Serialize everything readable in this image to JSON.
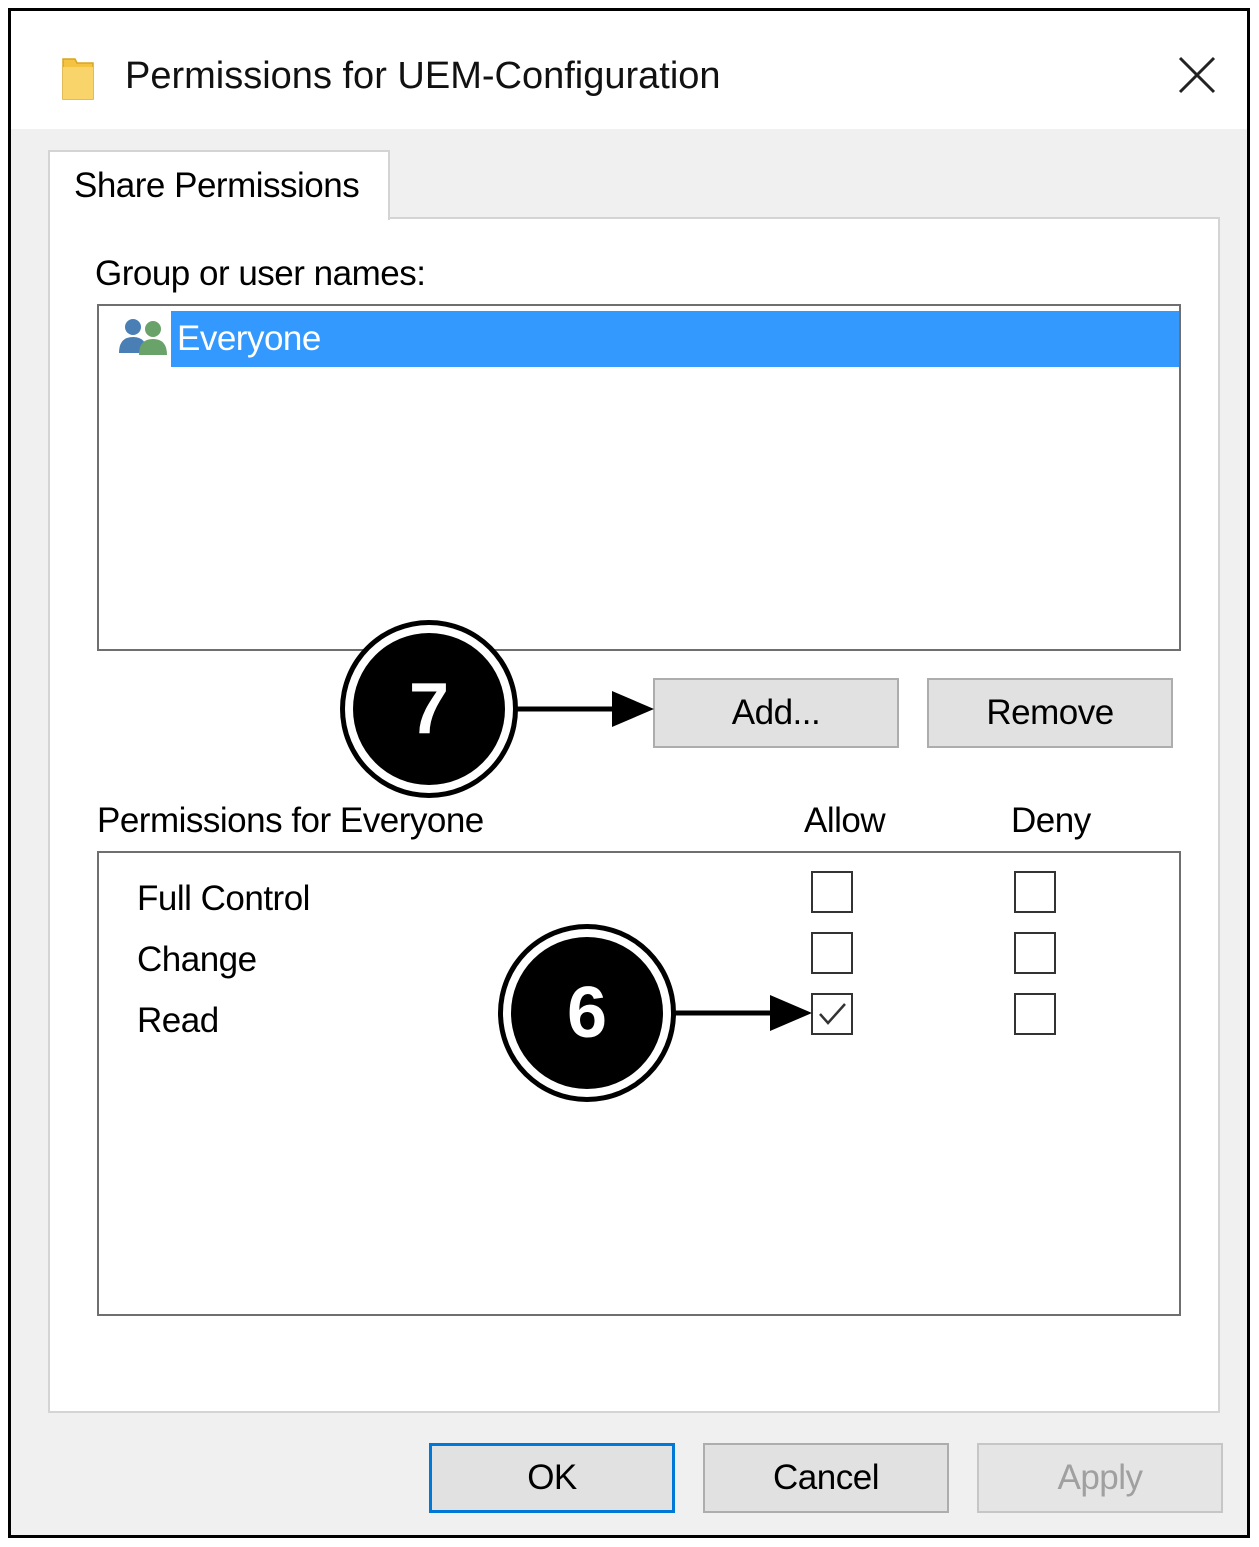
{
  "window": {
    "title": "Permissions for UEM-Configuration",
    "icon": "folder-icon",
    "close_icon": "close-icon"
  },
  "tabs": [
    {
      "label": "Share Permissions",
      "active": true
    }
  ],
  "group_section": {
    "label": "Group or user names:",
    "items": [
      {
        "name": "Everyone",
        "icon": "users-group-icon",
        "selected": true
      }
    ],
    "add_button": "Add...",
    "remove_button": "Remove"
  },
  "permissions_section": {
    "label": "Permissions for Everyone",
    "allow_header": "Allow",
    "deny_header": "Deny",
    "rows": [
      {
        "name": "Full Control",
        "allow": false,
        "deny": false
      },
      {
        "name": "Change",
        "allow": false,
        "deny": false
      },
      {
        "name": "Read",
        "allow": true,
        "deny": false
      }
    ]
  },
  "callouts": [
    {
      "number": "7",
      "points_to": "Add..."
    },
    {
      "number": "6",
      "points_to": "Read / Allow"
    }
  ],
  "footer": {
    "ok": "OK",
    "cancel": "Cancel",
    "apply": "Apply",
    "apply_enabled": false
  },
  "colors": {
    "selection": "#3399ff",
    "default_button_border": "#0078d7",
    "folder": "#f5c342"
  }
}
